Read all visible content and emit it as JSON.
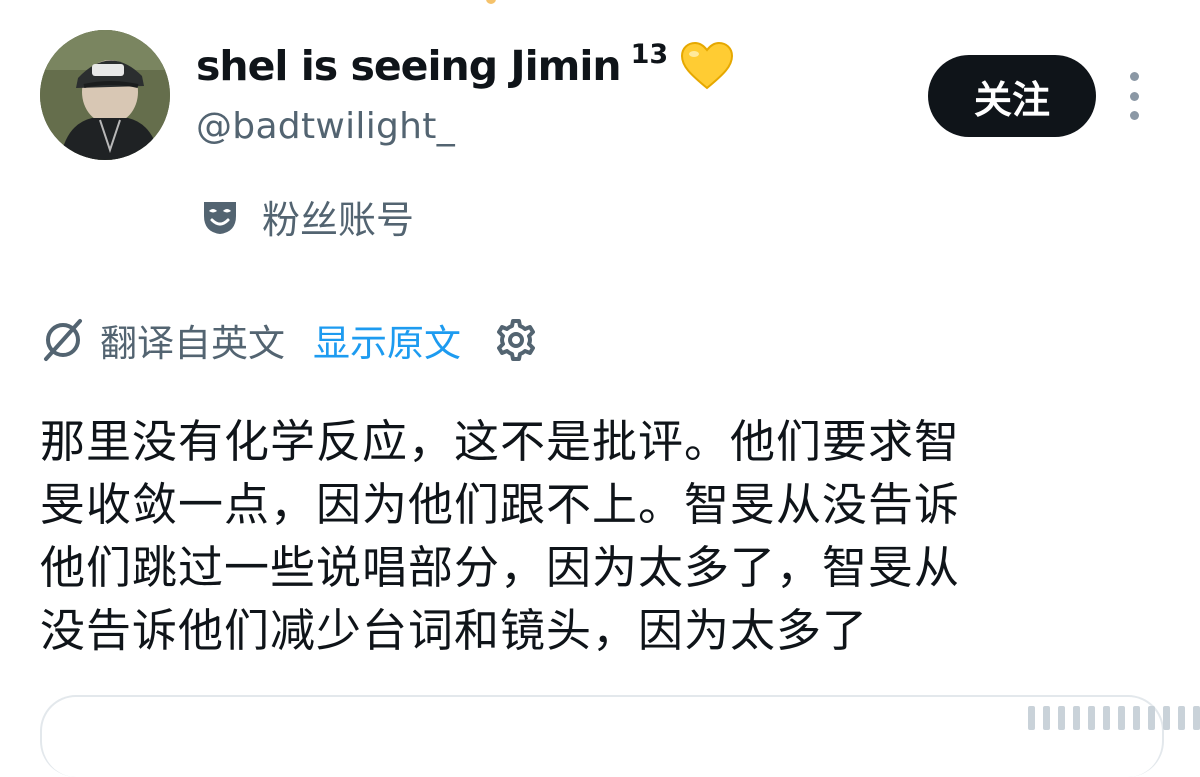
{
  "author": {
    "display_name": "shel is seeing Jimin",
    "superscript": "13",
    "emoji_icon": "yellow-heart-icon",
    "handle": "@badtwilight_",
    "label": "粉丝账号",
    "label_icon": "masquerade-mask-icon"
  },
  "actions": {
    "follow_label": "关注",
    "more_icon": "more-vertical-icon"
  },
  "translation": {
    "icon": "translate-icon",
    "label": "翻译自英文",
    "show_original": "显示原文",
    "settings_icon": "gear-icon"
  },
  "tweet": {
    "lines": [
      "那里没有化学反应，这不是批评。他们要求智",
      "旻收敛一点，因为他们跟不上。智旻从没告诉",
      "他们跳过一些说唱部分，因为太多了，智旻从",
      "没告诉他们减少台词和镜头，因为太多了"
    ]
  },
  "colors": {
    "text_primary": "#0f1419",
    "text_secondary": "#536471",
    "link": "#1d9bf0",
    "button_bg": "#0f1419",
    "heart": "#ffcc33"
  }
}
